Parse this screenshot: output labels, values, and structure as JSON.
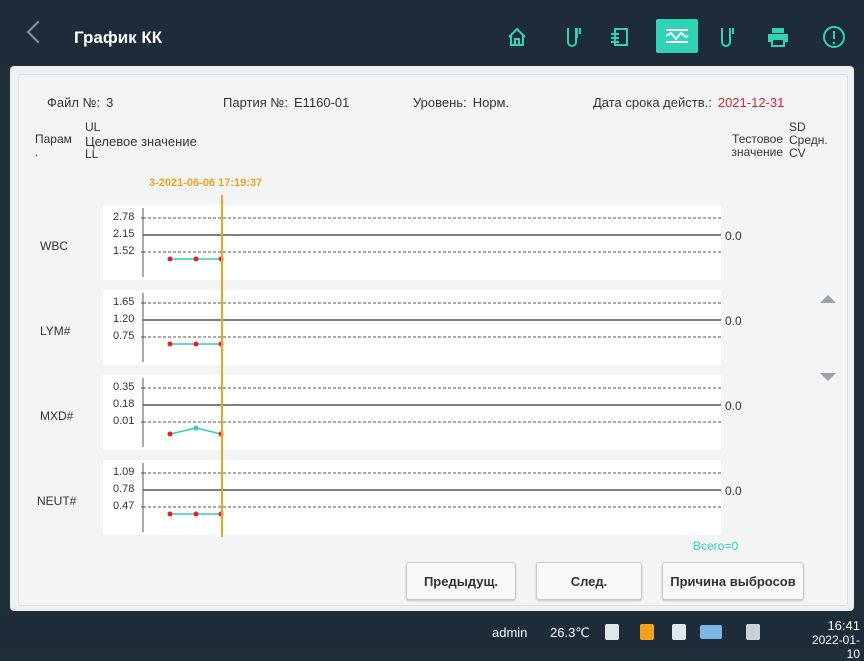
{
  "app": {
    "title": "График КК"
  },
  "toolbar": [
    {
      "icon": "home-icon"
    },
    {
      "icon": "test-tube-icon"
    },
    {
      "icon": "exit-icon"
    },
    {
      "icon": "qc-chart-icon",
      "active": true
    },
    {
      "icon": "reagent-tube-icon"
    },
    {
      "icon": "printer-icon"
    },
    {
      "icon": "alert-icon"
    }
  ],
  "header": {
    "file_label": "Файл №:",
    "file_value": "3",
    "lot_label": "Партия №:",
    "lot_value": "E1160-01",
    "level_label": "Уровень:",
    "level_value": "Норм.",
    "expiry_label": "Дата срока действ.:",
    "expiry_value": "2021-12-31"
  },
  "columns": {
    "param_line1": "Парам",
    "param_line2": ".",
    "ul": "UL",
    "target": "Целевое значение",
    "ll": "LL",
    "test_value_line1": "Тестовое",
    "test_value_line2": "значение",
    "sd": "SD",
    "mean": "Средн.",
    "cv": "CV"
  },
  "timestamp": "3-2021-06-06 17:19:37",
  "params": [
    {
      "name": "WBC",
      "ul": "2.78",
      "target": "2.15",
      "ll": "1.52",
      "result": "0.0"
    },
    {
      "name": "LYM#",
      "ul": "1.65",
      "target": "1.20",
      "ll": "0.75",
      "result": "0.0"
    },
    {
      "name": "MXD#",
      "ul": "0.35",
      "target": "0.18",
      "ll": "0.01",
      "result": "0.0"
    },
    {
      "name": "NEUT#",
      "ul": "1.09",
      "target": "0.78",
      "ll": "0.47",
      "result": "0.0"
    }
  ],
  "total": "Всего=0",
  "buttons": {
    "prev": "Предыдущ.",
    "next": "След.",
    "outlier": "Причина выбросов"
  },
  "status": {
    "user": "admin",
    "temperature": "26.3℃",
    "time": "16:41",
    "date": "2022-01-10"
  },
  "colors": {
    "accent": "#2fd3b5",
    "warning": "#f2a21d",
    "error": "#e3212b"
  }
}
